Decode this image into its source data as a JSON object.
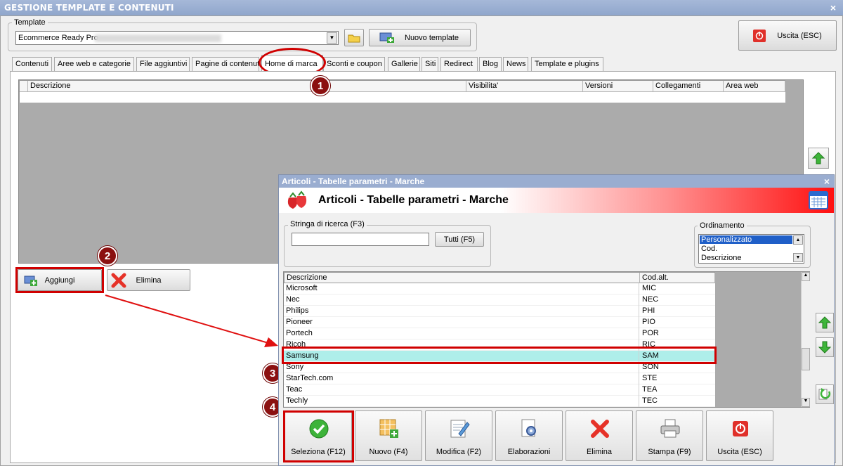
{
  "window": {
    "title": "GESTIONE TEMPLATE E CONTENUTI",
    "close": "×"
  },
  "template_group": {
    "label": "Template",
    "combo_value": "Ecommerce Ready Pro",
    "new_button": "Nuovo template"
  },
  "exit_button": "Uscita (ESC)",
  "tabs": [
    {
      "label": "Contenuti"
    },
    {
      "label": "Aree web e categorie"
    },
    {
      "label": "File aggiuntivi"
    },
    {
      "label": "Pagine di contenuti"
    },
    {
      "label": "Home di marca"
    },
    {
      "label": "Sconti e coupon"
    },
    {
      "label": "Gallerie"
    },
    {
      "label": "Siti"
    },
    {
      "label": "Redirect"
    },
    {
      "label": "Blog"
    },
    {
      "label": "News"
    },
    {
      "label": "Template e plugins"
    }
  ],
  "main_grid": {
    "columns": [
      "Descrizione",
      "Visibilita'",
      "Versioni",
      "Collegamenti",
      "Area web"
    ]
  },
  "main_buttons": {
    "add": "Aggiungi",
    "delete": "Elimina"
  },
  "badges": [
    "1",
    "2",
    "3",
    "4"
  ],
  "dialog": {
    "title": "Articoli - Tabelle parametri - Marche",
    "close": "×",
    "banner_title": "Articoli - Tabelle parametri - Marche",
    "search": {
      "label": "Stringa di ricerca (F3)",
      "value": "",
      "all_button": "Tutti (F5)"
    },
    "ordering": {
      "label": "Ordinamento",
      "options": [
        "Personalizzato",
        "Cod.",
        "Descrizione"
      ],
      "selected": "Personalizzato"
    },
    "grid": {
      "columns": [
        "Descrizione",
        "Cod.alt."
      ],
      "rows": [
        {
          "desc": "Microsoft",
          "code": "MIC"
        },
        {
          "desc": "Nec",
          "code": "NEC"
        },
        {
          "desc": "Philips",
          "code": "PHI"
        },
        {
          "desc": "Pioneer",
          "code": "PIO"
        },
        {
          "desc": "Portech",
          "code": "POR"
        },
        {
          "desc": "Ricoh",
          "code": "RIC"
        },
        {
          "desc": "Samsung",
          "code": "SAM"
        },
        {
          "desc": "Sony",
          "code": "SON"
        },
        {
          "desc": "StarTech.com",
          "code": "STE"
        },
        {
          "desc": "Teac",
          "code": "TEA"
        },
        {
          "desc": "Techly",
          "code": "TEC"
        }
      ],
      "selected_row": "Samsung"
    },
    "buttons": {
      "select": "Seleziona (F12)",
      "new": "Nuovo (F4)",
      "edit": "Modifica (F2)",
      "process": "Elaborazioni",
      "delete": "Elimina",
      "print": "Stampa (F9)",
      "exit": "Uscita (ESC)"
    }
  },
  "colors": {
    "annotation_red": "#d00000",
    "selected_row": "#aeeeea",
    "title_bar": "#8fa6cc"
  }
}
